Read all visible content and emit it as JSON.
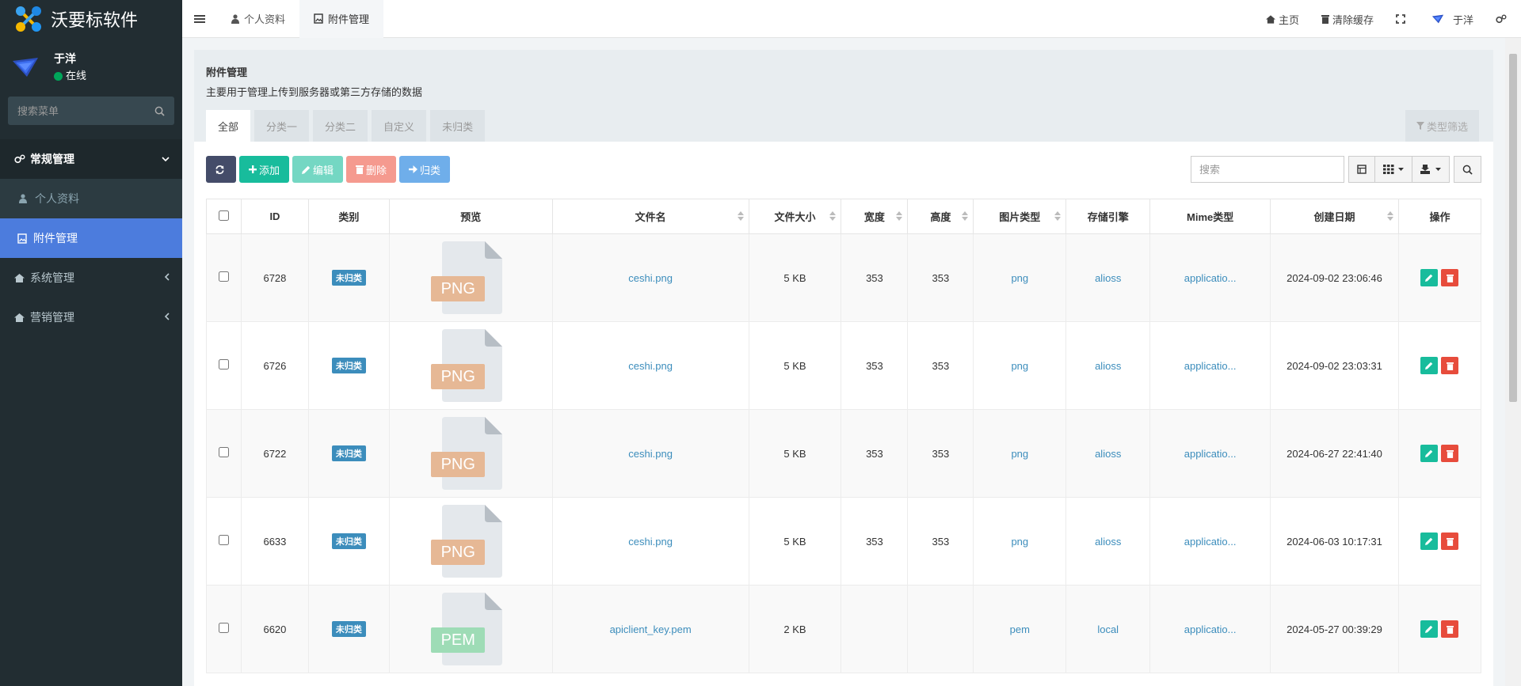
{
  "brand": {
    "title": "沃要标软件"
  },
  "user": {
    "name": "于洋",
    "status": "在线"
  },
  "sidebar": {
    "search_placeholder": "搜索菜单",
    "groups": [
      {
        "label": "常规管理",
        "items": [
          {
            "label": "个人资料"
          },
          {
            "label": "附件管理"
          }
        ]
      },
      {
        "label": "系统管理"
      },
      {
        "label": "营销管理"
      }
    ]
  },
  "topnav": {
    "tabs": [
      {
        "label": "个人资料"
      },
      {
        "label": "附件管理"
      }
    ],
    "right": {
      "home": "主页",
      "clear_cache": "清除缓存",
      "user": "于洋"
    }
  },
  "panel": {
    "title": "附件管理",
    "description": "主要用于管理上传到服务器或第三方存储的数据",
    "filter_tabs": [
      "全部",
      "分类一",
      "分类二",
      "自定义",
      "未归类"
    ],
    "type_filter": "类型筛选"
  },
  "toolbar": {
    "add": "添加",
    "edit": "编辑",
    "delete": "删除",
    "classify": "归类",
    "search_placeholder": "搜索"
  },
  "table": {
    "headers": [
      "ID",
      "类别",
      "预览",
      "文件名",
      "文件大小",
      "宽度",
      "高度",
      "图片类型",
      "存储引擎",
      "Mime类型",
      "创建日期",
      "操作"
    ],
    "rows": [
      {
        "id": "6728",
        "category": "未归类",
        "ext": "PNG",
        "filename": "ceshi.png",
        "size": "5 KB",
        "width": "353",
        "height": "353",
        "imagetype": "png",
        "storage": "alioss",
        "mime": "applicatio...",
        "created": "2024-09-02 23:06:46"
      },
      {
        "id": "6726",
        "category": "未归类",
        "ext": "PNG",
        "filename": "ceshi.png",
        "size": "5 KB",
        "width": "353",
        "height": "353",
        "imagetype": "png",
        "storage": "alioss",
        "mime": "applicatio...",
        "created": "2024-09-02 23:03:31"
      },
      {
        "id": "6722",
        "category": "未归类",
        "ext": "PNG",
        "filename": "ceshi.png",
        "size": "5 KB",
        "width": "353",
        "height": "353",
        "imagetype": "png",
        "storage": "alioss",
        "mime": "applicatio...",
        "created": "2024-06-27 22:41:40"
      },
      {
        "id": "6633",
        "category": "未归类",
        "ext": "PNG",
        "filename": "ceshi.png",
        "size": "5 KB",
        "width": "353",
        "height": "353",
        "imagetype": "png",
        "storage": "alioss",
        "mime": "applicatio...",
        "created": "2024-06-03 10:17:31"
      },
      {
        "id": "6620",
        "category": "未归类",
        "ext": "PEM",
        "filename": "apiclient_key.pem",
        "size": "2 KB",
        "width": "",
        "height": "",
        "imagetype": "pem",
        "storage": "local",
        "mime": "applicatio...",
        "created": "2024-05-27 00:39:29"
      }
    ]
  },
  "colors": {
    "png_label": "#e6b895",
    "pem_label": "#9edcb6"
  }
}
